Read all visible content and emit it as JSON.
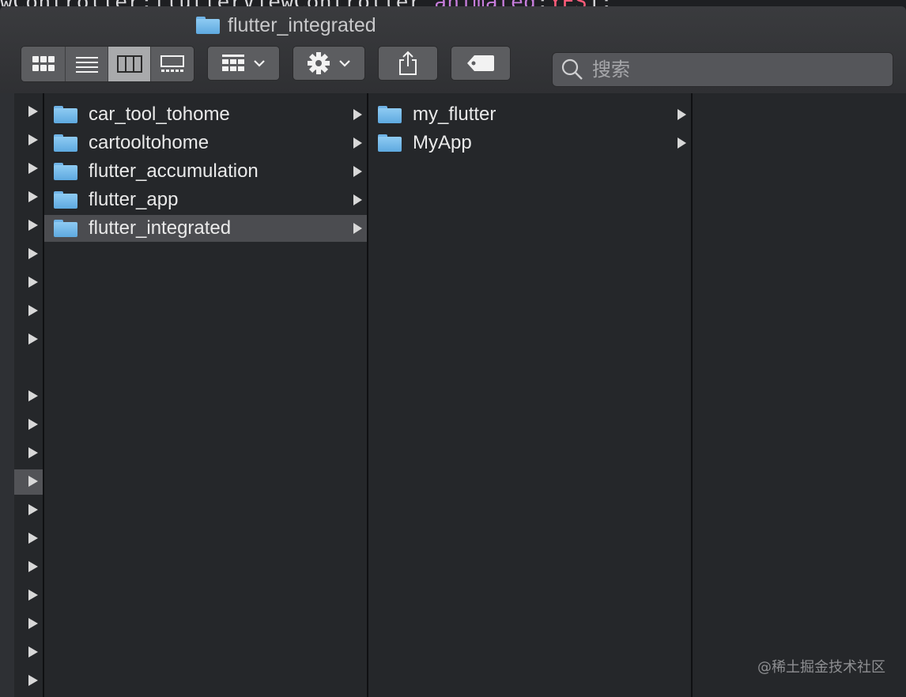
{
  "background_code": {
    "part1": "wController:flutterViewController ",
    "part2": "animated",
    "part3": ":",
    "part4": "YES",
    "part5": "];"
  },
  "window": {
    "title": "flutter_integrated"
  },
  "toolbar": {
    "view_modes": [
      "icon-view-icon",
      "list-view-icon",
      "column-view-icon",
      "gallery-view-icon"
    ],
    "active_view": "column-view-icon",
    "arrange_icon": "arrange-grid-icon",
    "action_icon": "gear-icon",
    "share_icon": "share-icon",
    "tag_icon": "tag-icon",
    "search_placeholder": "搜索"
  },
  "columns": {
    "first": {
      "items": [
        {
          "name": "car_tool_tohome",
          "selected": false
        },
        {
          "name": "cartooltohome",
          "selected": false
        },
        {
          "name": "flutter_accumulation",
          "selected": false
        },
        {
          "name": "flutter_app",
          "selected": false
        },
        {
          "name": "flutter_integrated",
          "selected": true
        }
      ]
    },
    "second": {
      "items": [
        {
          "name": "my_flutter",
          "selected": false
        },
        {
          "name": "MyApp",
          "selected": false
        }
      ]
    }
  },
  "colors": {
    "accent_folder": "#6fb3e6",
    "selection": "#4b4c50"
  },
  "watermark": "@稀土掘金技术社区"
}
